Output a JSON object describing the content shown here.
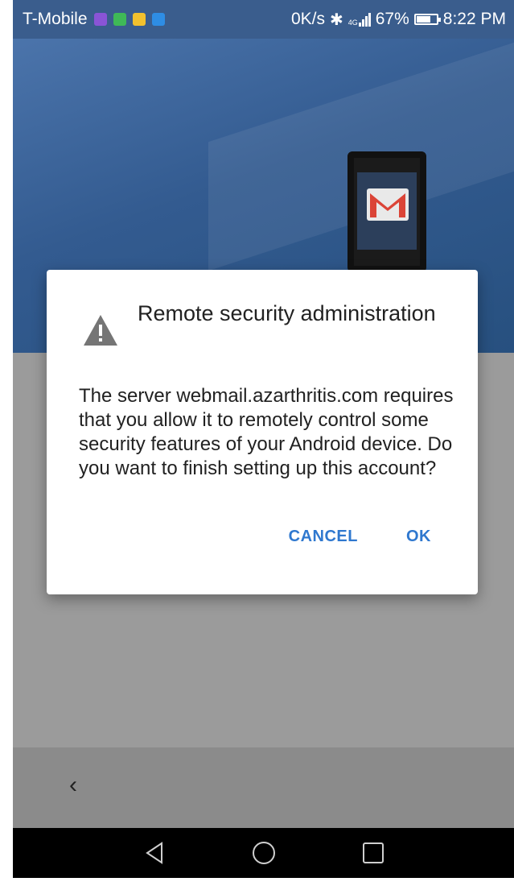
{
  "status_bar": {
    "carrier": "T-Mobile",
    "net_speed": "0K/s",
    "network_type": "4G",
    "battery": "67%",
    "time": "8:22 PM",
    "notification_colors": [
      "#8a54d6",
      "#3fb957",
      "#f2c12e",
      "#2e8de4"
    ]
  },
  "hero": {
    "icon": "gmail-phone-illustration",
    "brand_color": "#db4437"
  },
  "dialog": {
    "title": "Remote security administration",
    "body": "The server webmail.azarthritis.com requires that you allow it to remotely control some security features of your Android device. Do you want to finish setting up this account?",
    "icon": "warning-icon",
    "cancel_label": "CANCEL",
    "ok_label": "OK",
    "accent_color": "#2f78cf"
  },
  "app_footer": {
    "back_glyph": "‹"
  },
  "nav_bar": {
    "icons": [
      "back-triangle-icon",
      "home-circle-icon",
      "recents-square-icon"
    ]
  }
}
